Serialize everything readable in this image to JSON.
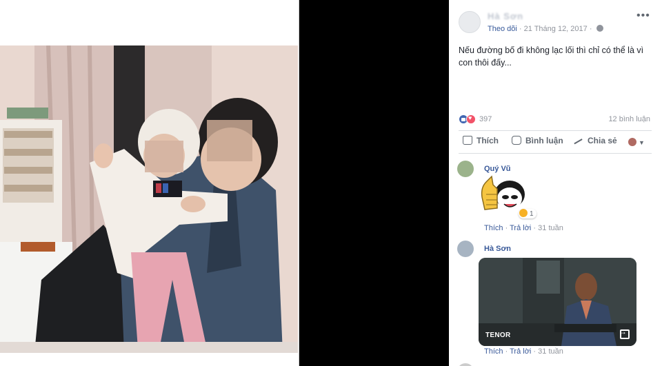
{
  "post": {
    "author_name": "Hà Sơn",
    "follow_label": "Theo dõi",
    "separator": "·",
    "date": "21 Tháng 12, 2017",
    "privacy_icon": "globe-icon",
    "caption": "Nếu đường bố đi không lạc lối thì chỉ có thể là vì con thôi đấy...",
    "reaction_icons": [
      "like-icon",
      "love-icon"
    ],
    "reaction_count": "397",
    "comment_count": "12 bình luận",
    "actions": {
      "like": "Thích",
      "comment": "Bình luận",
      "share": "Chia sẻ"
    }
  },
  "comments": [
    {
      "author": "Quý Vũ",
      "attachment": "sticker",
      "reaction_count": "1",
      "like_label": "Thích",
      "reply_label": "Trả lời",
      "time": "31 tuần"
    },
    {
      "author": "Hà Sơn",
      "attachment": "gif",
      "gif_provider": "TENOR",
      "like_label": "Thích",
      "reply_label": "Trả lời",
      "time": "31 tuần"
    }
  ],
  "colors": {
    "link": "#385898",
    "like_blue": "#4267b2",
    "love_red": "#f25268",
    "meta_gray": "#90949c"
  }
}
